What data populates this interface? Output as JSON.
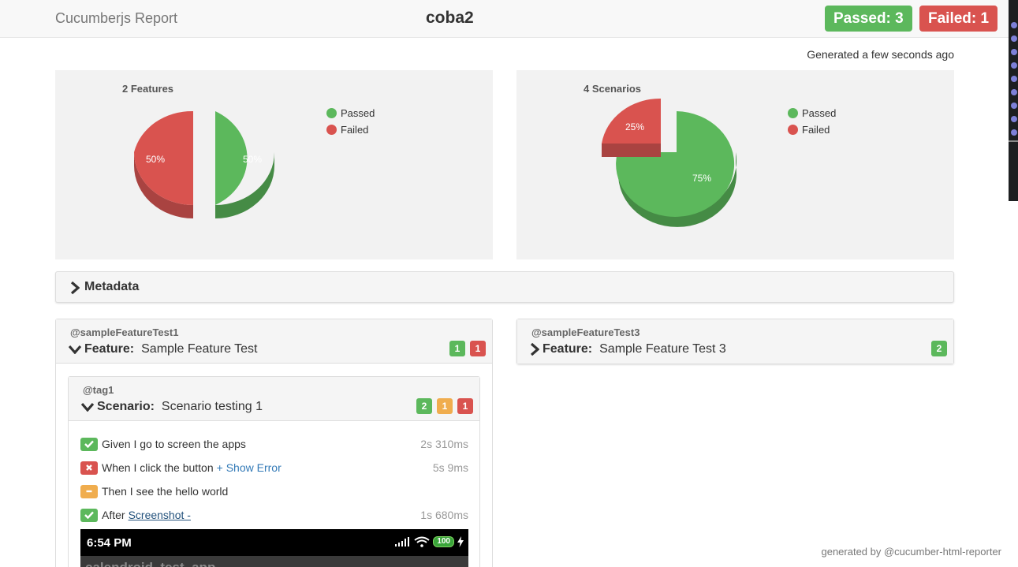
{
  "header": {
    "brand": "Cucumberjs Report",
    "project": "coba2",
    "passed_badge": "Passed: 3",
    "failed_badge": "Failed: 1"
  },
  "generated": "Generated a few seconds ago",
  "colors": {
    "passed": "#5cb85c",
    "failed": "#d9534f",
    "skipped": "#f0ad4e"
  },
  "chart_data": [
    {
      "type": "pie",
      "title": "2 Features",
      "categories": [
        "Passed",
        "Failed"
      ],
      "values": [
        50,
        50
      ],
      "legend": "top-right"
    },
    {
      "type": "pie",
      "title": "4 Scenarios",
      "categories": [
        "Passed",
        "Failed"
      ],
      "values": [
        75,
        25
      ],
      "legend": "top-right"
    }
  ],
  "slice_labels": {
    "features": {
      "passed": "50%",
      "failed": "50%"
    },
    "scenarios": {
      "passed": "75%",
      "failed": "25%"
    }
  },
  "metadata": {
    "label": "Metadata"
  },
  "features": [
    {
      "tag": "@sampleFeatureTest1",
      "keyword": "Feature:",
      "name": "Sample Feature Test",
      "badges": {
        "passed": "1",
        "failed": "1"
      },
      "expanded": true,
      "scenario": {
        "tag": "@tag1",
        "keyword": "Scenario:",
        "name": "Scenario testing 1",
        "badges": {
          "passed": "2",
          "skipped": "1",
          "failed": "1"
        },
        "steps": [
          {
            "status": "passed",
            "text": "Given I go to screen the apps",
            "time": "2s 310ms"
          },
          {
            "status": "failed",
            "text": "When I click the button",
            "extra": "+ Show Error",
            "time": "5s 9ms"
          },
          {
            "status": "skipped",
            "text": "Then I see the hello world",
            "time": ""
          },
          {
            "status": "passed",
            "text": "After",
            "link": "Screenshot -",
            "time": "1s 680ms"
          }
        ],
        "screenshot": {
          "time": "6:54 PM",
          "battery": "100",
          "app_title": "calendroid_test_app"
        }
      }
    },
    {
      "tag": "@sampleFeatureTest3",
      "keyword": "Feature:",
      "name": "Sample Feature Test 3",
      "badges": {
        "passed": "2"
      },
      "expanded": false
    }
  ],
  "footer": "generated by @cucumber-html-reporter"
}
